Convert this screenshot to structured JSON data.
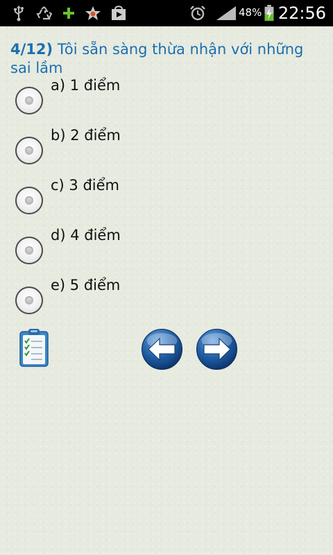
{
  "status_bar": {
    "battery_percent": "48%",
    "time": "22:56",
    "icons": [
      "usb-icon",
      "recycle-icon",
      "plus-icon",
      "star-icon",
      "play-store-icon",
      "alarm-icon",
      "signal-icon",
      "battery-charging-icon"
    ]
  },
  "question": {
    "number": "4/12)",
    "text": "Tôi sẵn sàng thừa nhận với những sai lầm"
  },
  "options": [
    {
      "label": "a) 1 điểm",
      "selected": false
    },
    {
      "label": "b) 2 điểm",
      "selected": false
    },
    {
      "label": "c) 3 điểm",
      "selected": false
    },
    {
      "label": "d) 4 điểm",
      "selected": false
    },
    {
      "label": "e) 5 điểm",
      "selected": false
    }
  ],
  "controls": {
    "clipboard_icon": "clipboard-checklist-icon",
    "back_icon": "arrow-left-icon",
    "next_icon": "arrow-right-icon"
  },
  "colors": {
    "question": "#1a6fb0",
    "background": "#e6eadf",
    "nav_button": "#1b5aa0"
  }
}
